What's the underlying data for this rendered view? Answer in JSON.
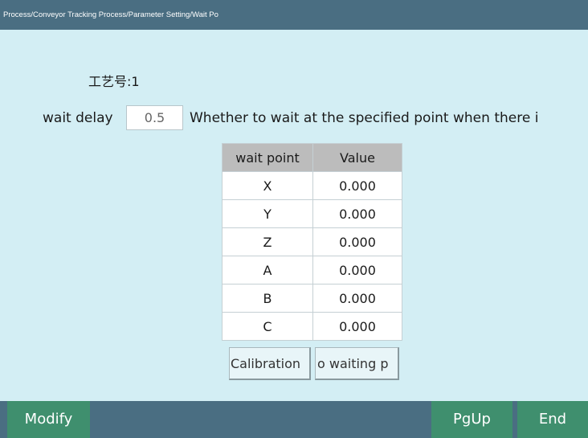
{
  "titlebar": {
    "breadcrumb": "Process/Conveyor Tracking Process/Parameter Setting/Wait Po"
  },
  "process": {
    "label": "工艺号:1"
  },
  "delay": {
    "label": "wait delay",
    "value": "0.5",
    "description": "Whether to wait at the specified point when there i"
  },
  "table": {
    "headers": [
      "wait point",
      "Value"
    ],
    "rows": [
      {
        "axis": "X",
        "value": "0.000"
      },
      {
        "axis": "Y",
        "value": "0.000"
      },
      {
        "axis": "Z",
        "value": "0.000"
      },
      {
        "axis": "A",
        "value": "0.000"
      },
      {
        "axis": "B",
        "value": "0.000"
      },
      {
        "axis": "C",
        "value": "0.000"
      }
    ]
  },
  "buttons": {
    "calibration": "Calibration",
    "waiting": "o waiting p"
  },
  "footer": {
    "modify": "Modify",
    "pgup": "PgUp",
    "end": "End"
  },
  "colors": {
    "titlebar": "#4a6e82",
    "background": "#d3eef4",
    "footer_button": "#3f8f6e",
    "table_header": "#bcbcbc"
  }
}
